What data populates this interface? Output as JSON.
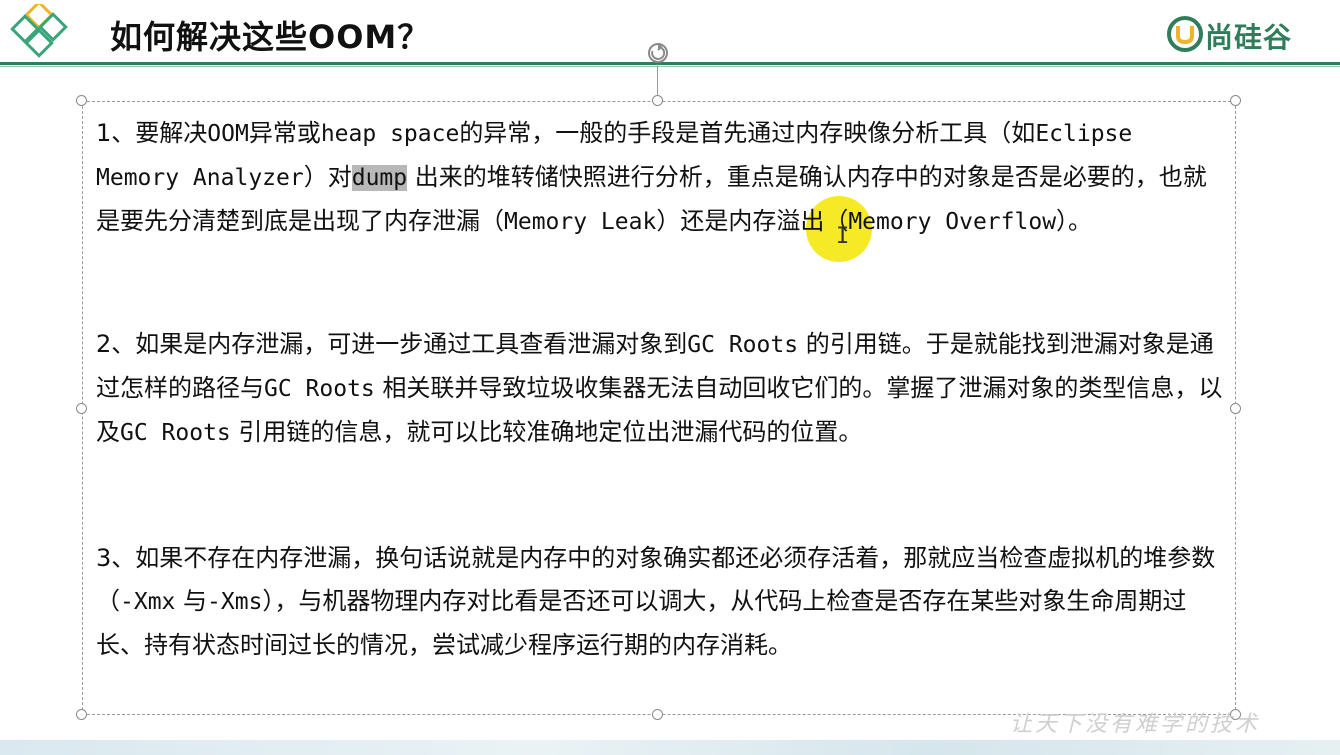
{
  "header": {
    "title": "如何解决这些OOM？",
    "brand": "尚硅谷",
    "brand_color": "#2e7d5b"
  },
  "content": {
    "p1_a": "1、要解决",
    "p1_b": "OOM",
    "p1_c": "异常或",
    "p1_d": "heap space",
    "p1_e": "的异常，一般的手段是首先通过内存映像分析工具（如",
    "p1_f": "Eclipse Memory Analyzer",
    "p1_g": "）对",
    "p1_h": "dump",
    "p1_i": " 出来的堆转储快照进行分析，重点是确认内存中的对象是否是必要的，也就是要先分清楚到底是出现了内存泄漏（",
    "p1_j": "Memory Leak",
    "p1_k": "）还是内存溢出（",
    "p1_l": "Memory Overflow",
    "p1_m": "）。",
    "p2_a": "2、如果是内存泄漏，可进一步通过工具查看泄漏对象到",
    "p2_b": "GC Roots",
    "p2_c": " 的引用链。于是就能找到泄漏对象是通过怎样的路径与",
    "p2_d": "GC Roots",
    "p2_e": " 相关联并导致垃圾收集器无法自动回收它们的。掌握了泄漏对象的类型信息，以及",
    "p2_f": "GC Roots",
    "p2_g": " 引用链的信息，就可以比较准确地定位出泄漏代码的位置。",
    "p3_a": "3、如果不存在内存泄漏，换句话说就是内存中的对象确实都还必须存活着，那就应当检查虚拟机的堆参数（",
    "p3_b": "-Xmx",
    "p3_c": " 与",
    "p3_d": "-Xms",
    "p3_e": "），与机器物理内存对比看是否还可以调大，从代码上检查是否存在某些对象生命周期过长、持有状态时间过长的情况，尝试减少程序运行期的内存消耗。"
  },
  "watermark": "让天下没有难学的技术"
}
